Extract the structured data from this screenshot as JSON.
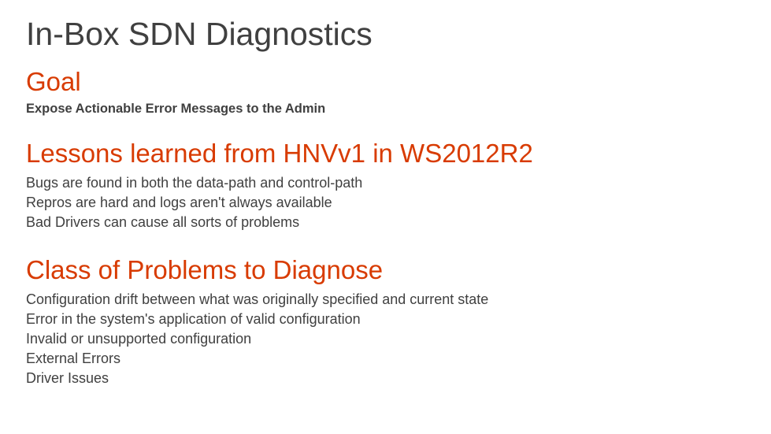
{
  "title": "In-Box SDN Diagnostics",
  "sections": [
    {
      "heading": "Goal",
      "subtitle": "Expose Actionable Error Messages to the Admin",
      "body": []
    },
    {
      "heading": "Lessons learned from HNVv1 in WS2012R2",
      "subtitle": null,
      "body": [
        "Bugs are found in both the data-path and control-path",
        "Repros are hard and logs aren't always available",
        "Bad Drivers can cause all sorts of problems"
      ]
    },
    {
      "heading": "Class of Problems to Diagnose",
      "subtitle": null,
      "body": [
        "Configuration drift between what was originally specified and current state",
        "Error in the system's application of valid configuration",
        "Invalid or unsupported configuration",
        "External Errors",
        "Driver Issues"
      ]
    }
  ]
}
